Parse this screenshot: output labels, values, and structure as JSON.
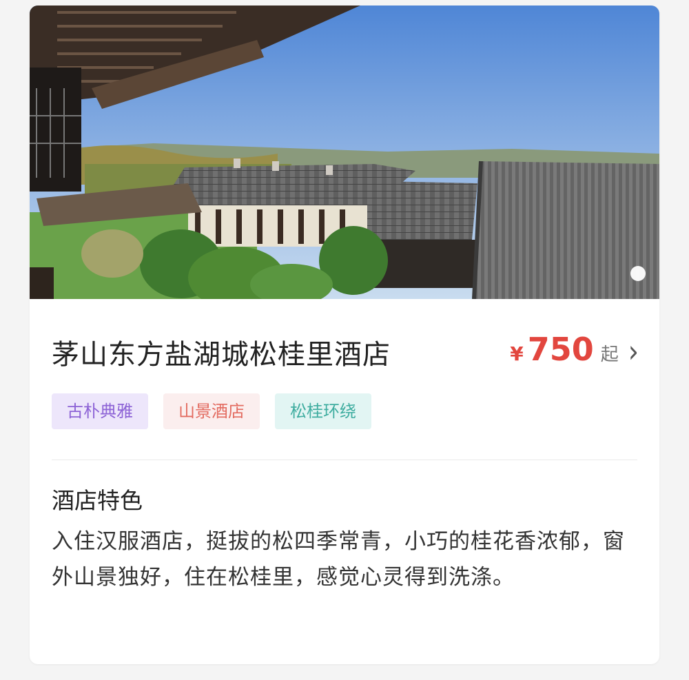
{
  "hotel": {
    "name": "茅山东方盐湖城松桂里酒店",
    "currency_symbol": "¥",
    "price": "750",
    "price_unit": "起",
    "tags": [
      "古朴典雅",
      "山景酒店",
      "松桂环绕"
    ],
    "feature_heading": "酒店特色",
    "feature_text": "入住汉服酒店，挺拔的松四季常青，小巧的桂花香浓郁，窗外山景独好，住在松桂里，感觉心灵得到洗涤。"
  },
  "icons": {
    "more": "chevron-right-icon",
    "carousel": "carousel-dot-icon"
  },
  "colors": {
    "price": "#e2463e",
    "tag_purple": "#8d63d6",
    "tag_red": "#e36b60",
    "tag_teal": "#3fada0"
  }
}
